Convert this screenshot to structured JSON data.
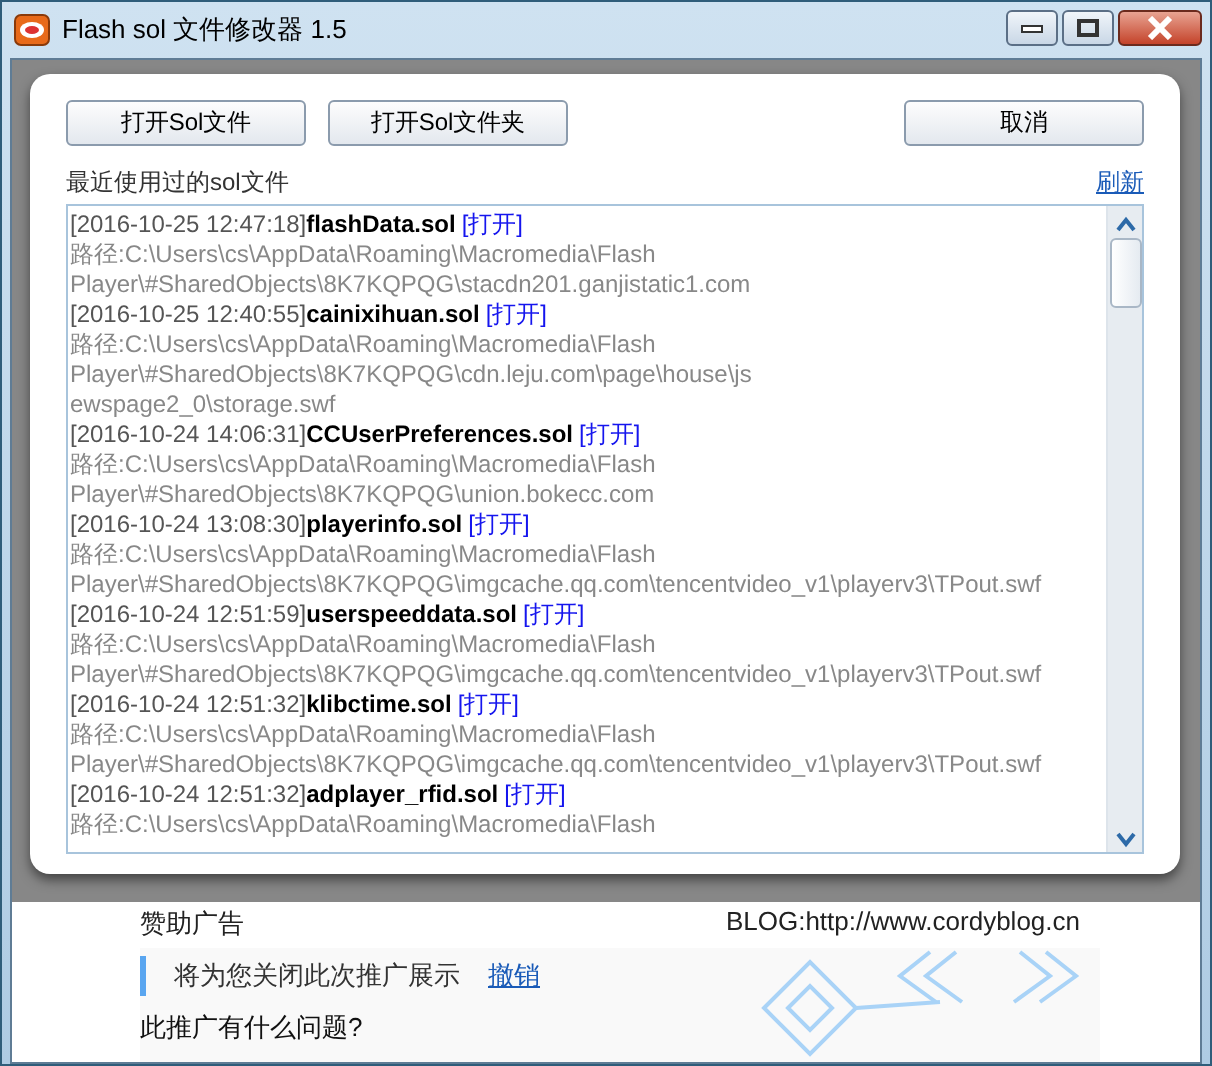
{
  "window": {
    "title": "Flash sol 文件修改器 1.5"
  },
  "dialog": {
    "buttons": [
      {
        "label": "打开Sol文件",
        "kind": "left"
      },
      {
        "label": "打开Sol文件夹",
        "kind": "left"
      },
      {
        "label": "取消",
        "kind": "right"
      }
    ],
    "recent_label": "最近使用过的sol文件",
    "refresh_link": "刷新",
    "entries": [
      {
        "time": "[2016-10-25 12:47:18]",
        "name": "flashData.sol",
        "open_link": "[打开]",
        "path_lines": [
          "路径:C:\\Users\\cs\\AppData\\Roaming\\Macromedia\\Flash",
          "Player\\#SharedObjects\\8K7KQPQG\\stacdn201.ganjistatic1.com"
        ]
      },
      {
        "time": "[2016-10-25 12:40:55]",
        "name": "cainixihuan.sol",
        "open_link": "[打开]",
        "path_lines": [
          "路径:C:\\Users\\cs\\AppData\\Roaming\\Macromedia\\Flash",
          "Player\\#SharedObjects\\8K7KQPQG\\cdn.leju.com\\page\\house\\js",
          "ewspage2_0\\storage.swf"
        ]
      },
      {
        "time": "[2016-10-24 14:06:31]",
        "name": "CCUserPreferences.sol",
        "open_link": "[打开]",
        "path_lines": [
          "路径:C:\\Users\\cs\\AppData\\Roaming\\Macromedia\\Flash",
          "Player\\#SharedObjects\\8K7KQPQG\\union.bokecc.com"
        ]
      },
      {
        "time": "[2016-10-24 13:08:30]",
        "name": "playerinfo.sol",
        "open_link": "[打开]",
        "path_lines": [
          "路径:C:\\Users\\cs\\AppData\\Roaming\\Macromedia\\Flash",
          "Player\\#SharedObjects\\8K7KQPQG\\imgcache.qq.com\\tencentvideo_v1\\playerv3\\TPout.swf"
        ]
      },
      {
        "time": "[2016-10-24 12:51:59]",
        "name": "userspeeddata.sol",
        "open_link": "[打开]",
        "path_lines": [
          "路径:C:\\Users\\cs\\AppData\\Roaming\\Macromedia\\Flash",
          "Player\\#SharedObjects\\8K7KQPQG\\imgcache.qq.com\\tencentvideo_v1\\playerv3\\TPout.swf"
        ]
      },
      {
        "time": "[2016-10-24 12:51:32]",
        "name": "klibctime.sol",
        "open_link": "[打开]",
        "path_lines": [
          "路径:C:\\Users\\cs\\AppData\\Roaming\\Macromedia\\Flash",
          "Player\\#SharedObjects\\8K7KQPQG\\imgcache.qq.com\\tencentvideo_v1\\playerv3\\TPout.swf"
        ]
      },
      {
        "time": "[2016-10-24 12:51:32]",
        "name": "adplayer_rfid.sol",
        "open_link": "[打开]",
        "path_lines": [
          "路径:C:\\Users\\cs\\AppData\\Roaming\\Macromedia\\Flash"
        ]
      }
    ]
  },
  "ad": {
    "label": "赞助广告",
    "blog": "BLOG:http://www.cordyblog.cn",
    "notice": "将为您关闭此次推广展示",
    "undo_link": "撤销",
    "question": "此推广有什么问题?"
  }
}
